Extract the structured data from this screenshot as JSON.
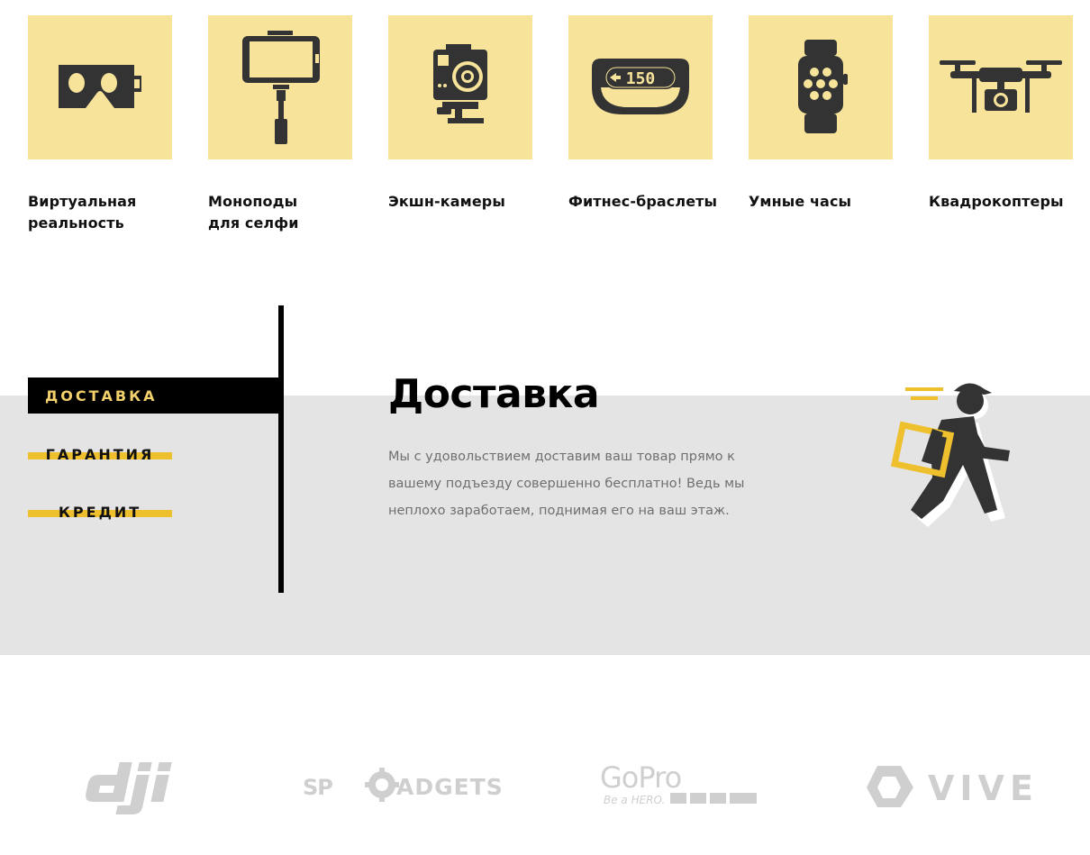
{
  "categories": [
    {
      "label": "Виртуальная\nреальность",
      "icon": "vr-headset-icon"
    },
    {
      "label": "Моноподы\nдля селфи",
      "icon": "selfie-stick-icon"
    },
    {
      "label": "Экшн-камеры",
      "icon": "action-camera-icon"
    },
    {
      "label": "Фитнес-браслеты",
      "icon": "fitness-band-icon",
      "display_value": "150"
    },
    {
      "label": "Умные часы",
      "icon": "smartwatch-icon"
    },
    {
      "label": "Квадрокоптеры",
      "icon": "drone-icon"
    }
  ],
  "info": {
    "tabs": [
      {
        "label": "ДОСТАВКА",
        "active": true
      },
      {
        "label": "ГАРАНТИЯ",
        "active": false
      },
      {
        "label": "КРЕДИТ",
        "active": false
      }
    ],
    "title": "Доставка",
    "text": "Мы с удовольствием доставим ваш товар прямо к вашему подъезду совершенно бесплатно! Ведь мы неплохо заработаем, поднимая его на ваш этаж.",
    "illustration": "courier-running-icon"
  },
  "brands": [
    {
      "name": "dji",
      "logo_text": "dji"
    },
    {
      "name": "sp-gadgets",
      "logo_text": "SP GADGETS"
    },
    {
      "name": "gopro",
      "logo_text": "GoPro",
      "tagline": "Be a HERO."
    },
    {
      "name": "vive",
      "logo_text": "VIVE"
    }
  ],
  "colors": {
    "tile_bg": "#f7e39a",
    "accent": "#efc02e",
    "active_tab_text": "#f2d06b",
    "band_bg": "#e4e4e4",
    "icon_dark": "#333333",
    "brand_gray": "#cfcfcf"
  }
}
